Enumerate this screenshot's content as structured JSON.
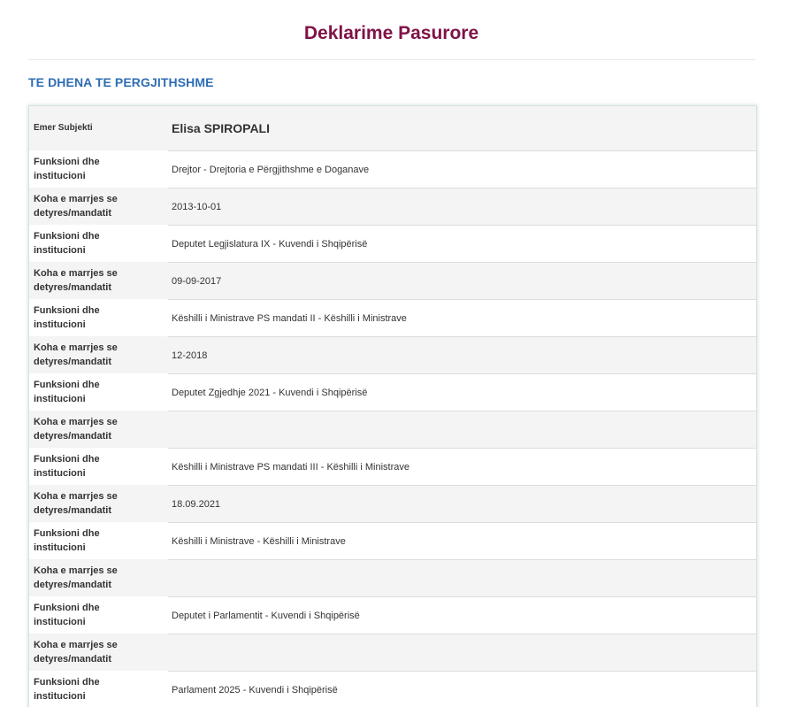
{
  "page": {
    "title": "Deklarime Pasurore",
    "section_heading": "TE DHENA TE PERGJITHSHME"
  },
  "subject": {
    "label": "Emer Subjekti",
    "value": "Elisa SPIROPALI"
  },
  "rows": [
    {
      "label": "Funksioni dhe institucioni",
      "value": "Drejtor - Drejtoria e Përgjithshme e Doganave"
    },
    {
      "label": "Koha e marrjes se detyres/mandatit",
      "value": "2013-10-01"
    },
    {
      "label": "Funksioni dhe institucioni",
      "value": "Deputet Legjislatura IX - Kuvendi i Shqipërisë"
    },
    {
      "label": "Koha e marrjes se detyres/mandatit",
      "value": "09-09-2017"
    },
    {
      "label": "Funksioni dhe institucioni",
      "value": "Këshilli i Ministrave PS mandati II - Këshilli i Ministrave"
    },
    {
      "label": "Koha e marrjes se detyres/mandatit",
      "value": "12-2018"
    },
    {
      "label": "Funksioni dhe institucioni",
      "value": "Deputet Zgjedhje 2021 - Kuvendi i Shqipërisë"
    },
    {
      "label": "Koha e marrjes se detyres/mandatit",
      "value": ""
    },
    {
      "label": "Funksioni dhe institucioni",
      "value": "Këshilli i Ministrave PS mandati III - Këshilli i Ministrave"
    },
    {
      "label": "Koha e marrjes se detyres/mandatit",
      "value": "18.09.2021"
    },
    {
      "label": "Funksioni dhe institucioni",
      "value": "Këshilli i Ministrave - Këshilli i Ministrave"
    },
    {
      "label": "Koha e marrjes se detyres/mandatit",
      "value": ""
    },
    {
      "label": "Funksioni dhe institucioni",
      "value": "Deputet i Parlamentit - Kuvendi i Shqipërisë"
    },
    {
      "label": "Koha e marrjes se detyres/mandatit",
      "value": ""
    },
    {
      "label": "Funksioni dhe institucioni",
      "value": "Parlament 2025 - Kuvendi i Shqipërisë"
    }
  ],
  "colors": {
    "title": "#7f1246",
    "section_heading": "#2e6db4",
    "row_stripe": "#f4f4f4",
    "text": "#333333"
  }
}
